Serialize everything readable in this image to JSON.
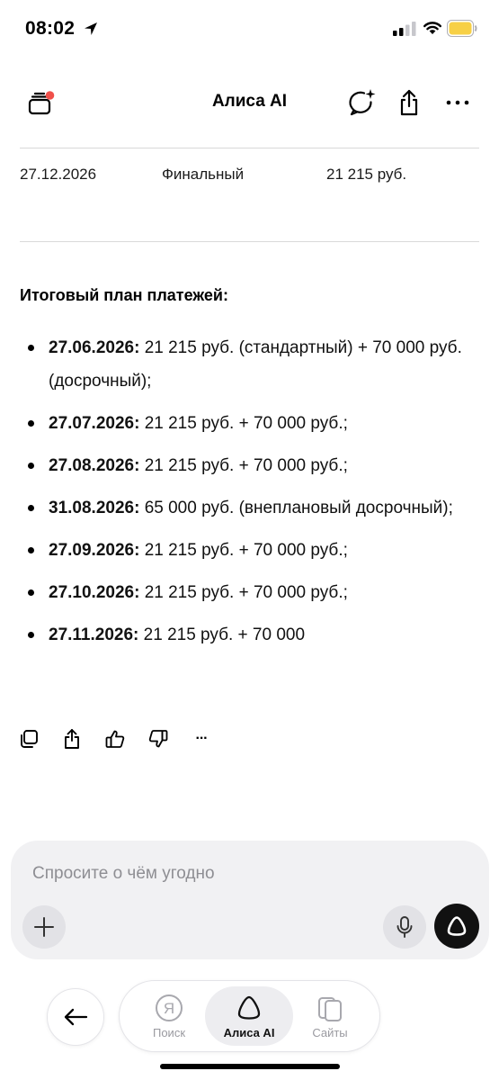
{
  "status_bar": {
    "time": "08:02"
  },
  "header": {
    "title": "Алиса AI"
  },
  "table_row": {
    "date": "27.12.2026",
    "type": "Финальный",
    "amount": "21 215 руб."
  },
  "plan": {
    "heading": "Итоговый план платежей:",
    "items": [
      {
        "date": "27.06.2026:",
        "text": " 21 215 руб. (стандартный) + 70 000 руб. (досрочный);"
      },
      {
        "date": "27.07.2026:",
        "text": " 21 215 руб. + 70 000 руб.;"
      },
      {
        "date": "27.08.2026:",
        "text": " 21 215 руб. + 70 000 руб.;"
      },
      {
        "date": "31.08.2026:",
        "text": " 65 000 руб. (внеплановый досрочный);"
      },
      {
        "date": "27.09.2026:",
        "text": " 21 215 руб. + 70 000 руб.;"
      },
      {
        "date": "27.10.2026:",
        "text": " 21 215 руб. + 70 000 руб.;"
      },
      {
        "date": "27.11.2026:",
        "text": " 21 215 руб. + 70 000"
      }
    ]
  },
  "actions": {
    "more": "···"
  },
  "composer": {
    "placeholder": "Спросите о чём угодно"
  },
  "tabbar": {
    "search_label": "Поиск",
    "search_icon_letter": "Я",
    "alice_label": "Алиса AI",
    "sites_label": "Сайты"
  },
  "colors": {
    "badge": "#f0504a",
    "battery": "#f7d046",
    "accent": "#111111"
  }
}
